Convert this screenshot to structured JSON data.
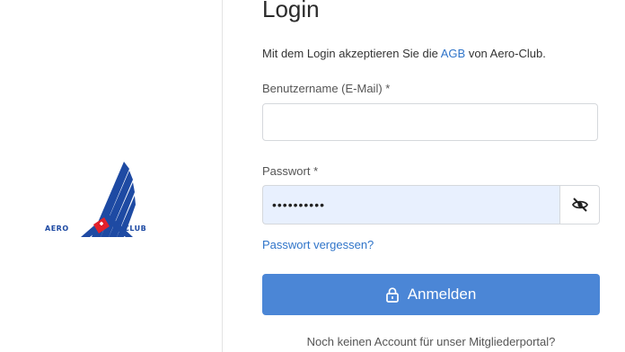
{
  "logo": {
    "left_text": "AERO",
    "right_text": "CLUB"
  },
  "login": {
    "title": "Login",
    "terms_prefix": "Mit dem Login akzeptieren Sie die ",
    "terms_link": "AGB",
    "terms_suffix": " von Aero-Club.",
    "username_label": "Benutzername (E-Mail) *",
    "username_value": "",
    "password_label": "Passwort *",
    "password_value": "••••••••••",
    "password_toggle_icon": "eye-slash-icon",
    "forgot_link": "Passwort vergessen?",
    "submit_label": "Anmelden",
    "submit_icon": "lock-icon",
    "signup_text": "Noch keinen Account für unser Mitgliederportal?"
  },
  "colors": {
    "primary": "#4b86d6",
    "link": "#2f74c9",
    "autofill_bg": "#e8f0fe",
    "logo_blue": "#1e4aa3",
    "logo_red": "#e2212b"
  }
}
